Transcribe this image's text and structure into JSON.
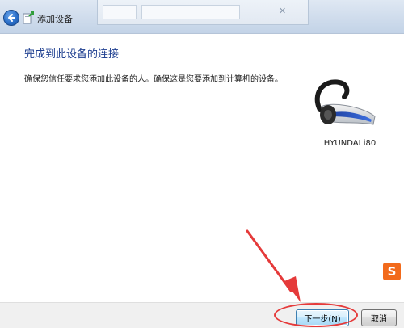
{
  "window": {
    "title": "添加设备"
  },
  "content": {
    "heading": "完成到此设备的连接",
    "description": "确保您信任要求您添加此设备的人。确保这是您要添加到计算机的设备。"
  },
  "device": {
    "name": "HYUNDAI i80",
    "icon": "bluetooth-headset-icon"
  },
  "buttons": {
    "next": "下一步(N)",
    "cancel": "取消"
  },
  "watermark": {
    "glyph": "S"
  },
  "colors": {
    "heading": "#1e3f90",
    "annotation": "#e53a3a",
    "watermark": "#f26a1b"
  }
}
